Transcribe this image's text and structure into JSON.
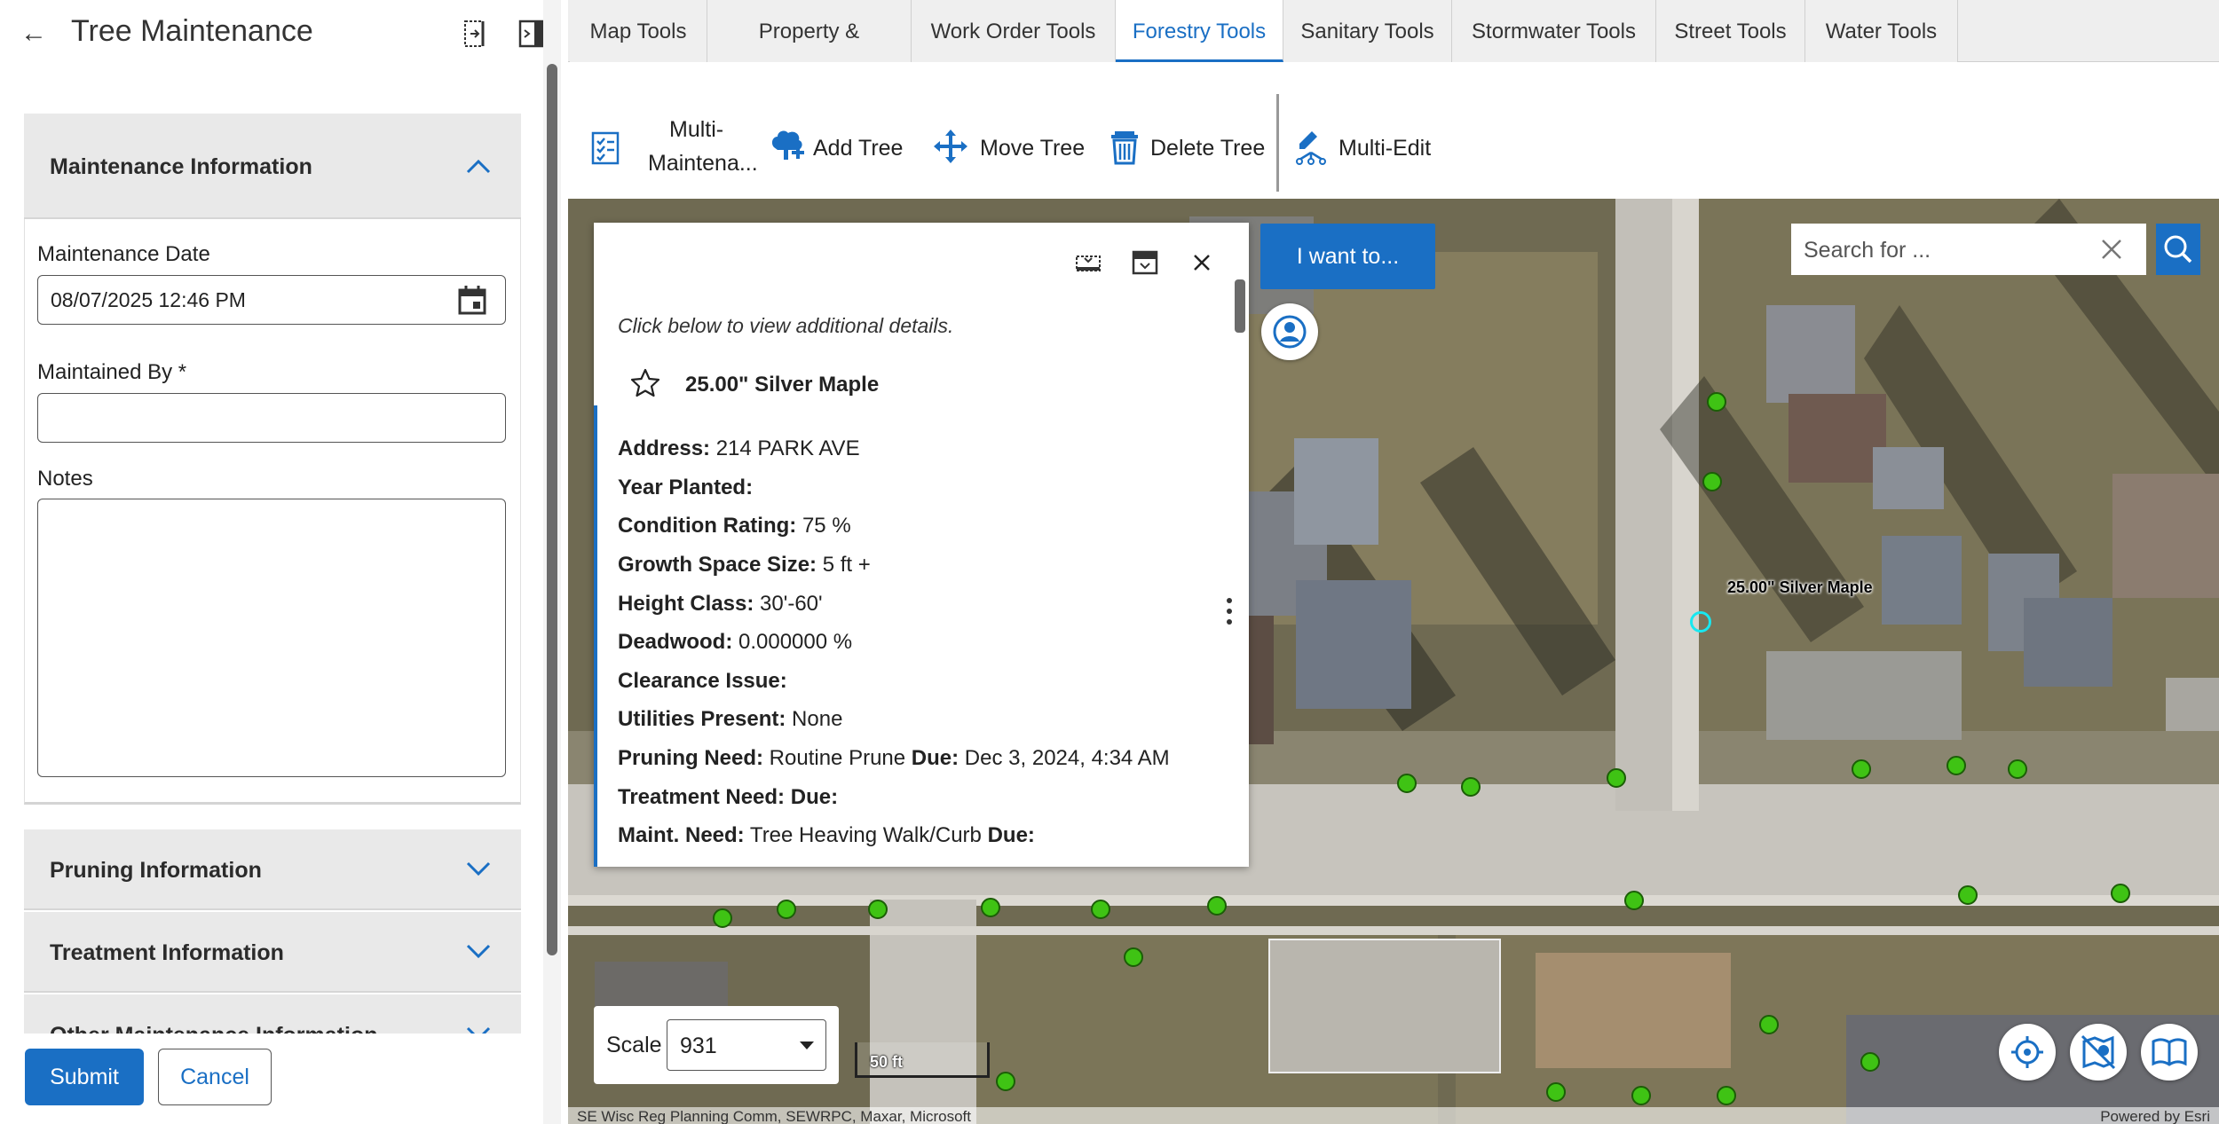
{
  "panel": {
    "title": "Tree Maintenance",
    "sections": {
      "maintenance": "Maintenance Information",
      "pruning": "Pruning Information",
      "treatment": "Treatment Information",
      "other": "Other Maintenance Information"
    },
    "fields": {
      "date_label": "Maintenance Date",
      "date_value": "08/07/2025 12:46 PM",
      "maintained_by_label": "Maintained By  *",
      "maintained_by_value": "",
      "notes_label": "Notes",
      "notes_value": ""
    },
    "buttons": {
      "submit": "Submit",
      "cancel": "Cancel"
    }
  },
  "tabs": [
    "Map Tools",
    "Property & Document Tools",
    "Work Order Tools",
    "Forestry Tools",
    "Sanitary Tools",
    "Stormwater Tools",
    "Street Tools",
    "Water Tools"
  ],
  "active_tab": "Forestry Tools",
  "toolbar": {
    "multi_maint_line1": "Multi-",
    "multi_maint_line2": "Maintena...",
    "add_tree": "Add Tree",
    "move_tree": "Move Tree",
    "delete_tree": "Delete Tree",
    "multi_edit": "Multi-Edit"
  },
  "popup": {
    "hint": "Click below to view additional details.",
    "title": "25.00\" Silver Maple",
    "attributes": [
      {
        "label": "Address:",
        "value": " 214 PARK AVE"
      },
      {
        "label": "Year Planted:",
        "value": ""
      },
      {
        "label": "Condition Rating:",
        "value": " 75 %"
      },
      {
        "label": "Growth Space Size:",
        "value": " 5 ft +"
      },
      {
        "label": "Height Class:",
        "value": " 30'-60'"
      },
      {
        "label": "Deadwood:",
        "value": " 0.000000 %"
      },
      {
        "label": "Clearance Issue:",
        "value": ""
      },
      {
        "label": "Utilities Present:",
        "value": " None"
      },
      {
        "label": "Pruning Need:",
        "value": " Routine Prune ",
        "label2": "Due:",
        "value2": " Dec 3, 2024, 4:34 AM"
      },
      {
        "label": "Treatment Need:",
        "value": "  ",
        "label2": "Due:",
        "value2": ""
      },
      {
        "label": "Maint. Need:",
        "value": " Tree Heaving Walk/Curb ",
        "label2": "Due:",
        "value2": ""
      }
    ]
  },
  "map": {
    "i_want_to": "I want to...",
    "search_placeholder": "Search for ...",
    "tree_label": "25.00\" Silver Maple",
    "scale_label": "Scale",
    "scale_value": "931",
    "scale_bar_text": "50 ft",
    "attribution_left": "SE Wisc Reg Planning Comm, SEWRPC, Maxar, Microsoft",
    "attribution_right": "Powered by Esri"
  },
  "colors": {
    "accent": "#1a6fc4",
    "tree": "#3fc314",
    "selection": "#18e8f0"
  }
}
